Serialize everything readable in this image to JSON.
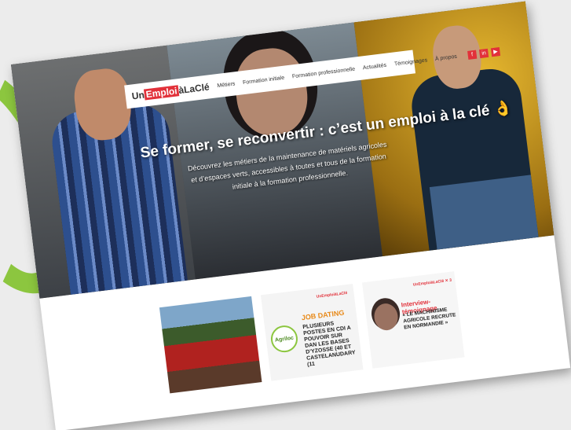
{
  "logo": {
    "part1": "Un",
    "part2": "Emploi",
    "part3": "àLaClé"
  },
  "nav": {
    "items": [
      "Métiers",
      "Formation initiale",
      "Formation professionnelle",
      "Actualités",
      "Témoignages",
      "À propos"
    ]
  },
  "social": [
    "f",
    "in",
    "▶"
  ],
  "hero": {
    "headline": "Se former, se reconvertir : c’est un emploi à la clé 👌",
    "subtitle": "Découvrez les métiers de la maintenance de matériels agricoles et d’espaces verts, accessibles à toutes et tous de la formation initiale à la formation professionnelle."
  },
  "tiles": {
    "job_dating": {
      "logo": "Agriloc",
      "title": "JOB DATING",
      "text": "PLUSIEURS POSTES EN CDI A POUVOIR SUR DAN LES BASES D’YZOSSE (40 ET CASTELANUDARY (11"
    },
    "interview": {
      "title": "Interview-témoignage",
      "text": "« LE MACHINISME AGRICOLE RECRUTE EN NORMANDIE »"
    }
  },
  "colors": {
    "accent": "#e2313a",
    "green": "#8cc63f"
  }
}
